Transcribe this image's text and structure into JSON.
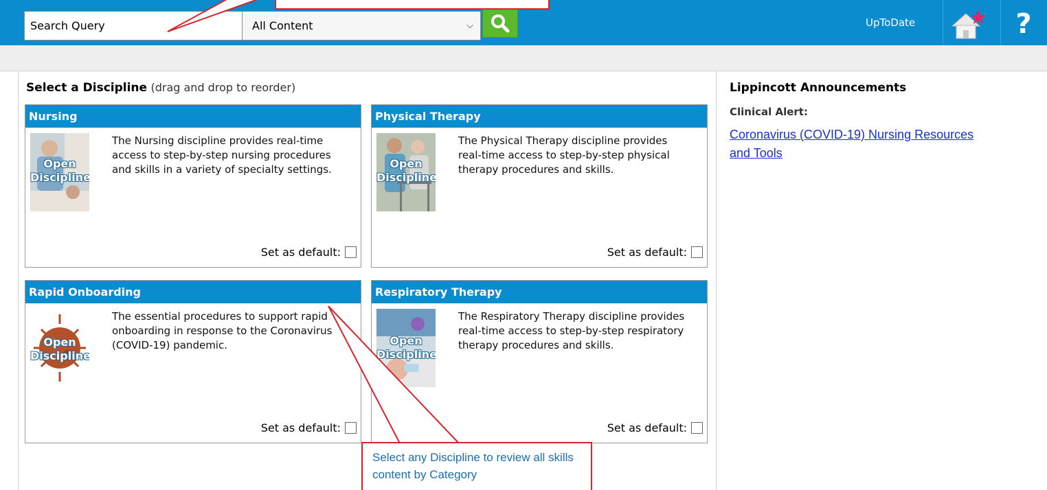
{
  "search": {
    "placeholder": "Search Query",
    "content_filter": "All Content"
  },
  "header": {
    "uptodate_label": "UpToDate"
  },
  "main": {
    "heading": "Select a Discipline",
    "heading_hint": "(drag and drop to reorder)",
    "cards": [
      {
        "title": "Nursing",
        "thumb_label_1": "Open",
        "thumb_label_2": "Discipline",
        "description": "The Nursing discipline provides real-time access to step-by-step nursing procedures and skills in a variety of specialty settings.",
        "default_label": "Set as default:"
      },
      {
        "title": "Physical Therapy",
        "thumb_label_1": "Open",
        "thumb_label_2": "Discipline",
        "description": "The Physical Therapy discipline provides real-time access to step-by-step physical therapy procedures and skills.",
        "default_label": "Set as default:"
      },
      {
        "title": "Rapid Onboarding",
        "thumb_label_1": "Open",
        "thumb_label_2": "Discipline",
        "description": "The essential procedures to support rapid onboarding in response to the Coronavirus (COVID-19) pandemic.",
        "default_label": "Set as default:"
      },
      {
        "title": "Respiratory Therapy",
        "thumb_label_1": "Open",
        "thumb_label_2": "Discipline",
        "description": "The Respiratory Therapy discipline provides real-time access to step-by-step respiratory therapy procedures and skills.",
        "default_label": "Set as default:"
      }
    ]
  },
  "announcements": {
    "title": "Lippincott Announcements",
    "alert_label": "Clinical Alert:",
    "link_text": "Coronavirus (COVID-19) Nursing Resources and Tools"
  },
  "callout": {
    "text": "Select any Discipline to review all skills content by Category"
  },
  "colors": {
    "brand_blue": "#0a8ccf",
    "search_green": "#5cb82e",
    "callout_red": "#d8232a",
    "link_blue": "#1a2fd8"
  },
  "icons": {
    "search": "magnifier-icon",
    "home": "home-star-icon",
    "help": "question-icon",
    "dropdown": "chevron-down-icon"
  }
}
